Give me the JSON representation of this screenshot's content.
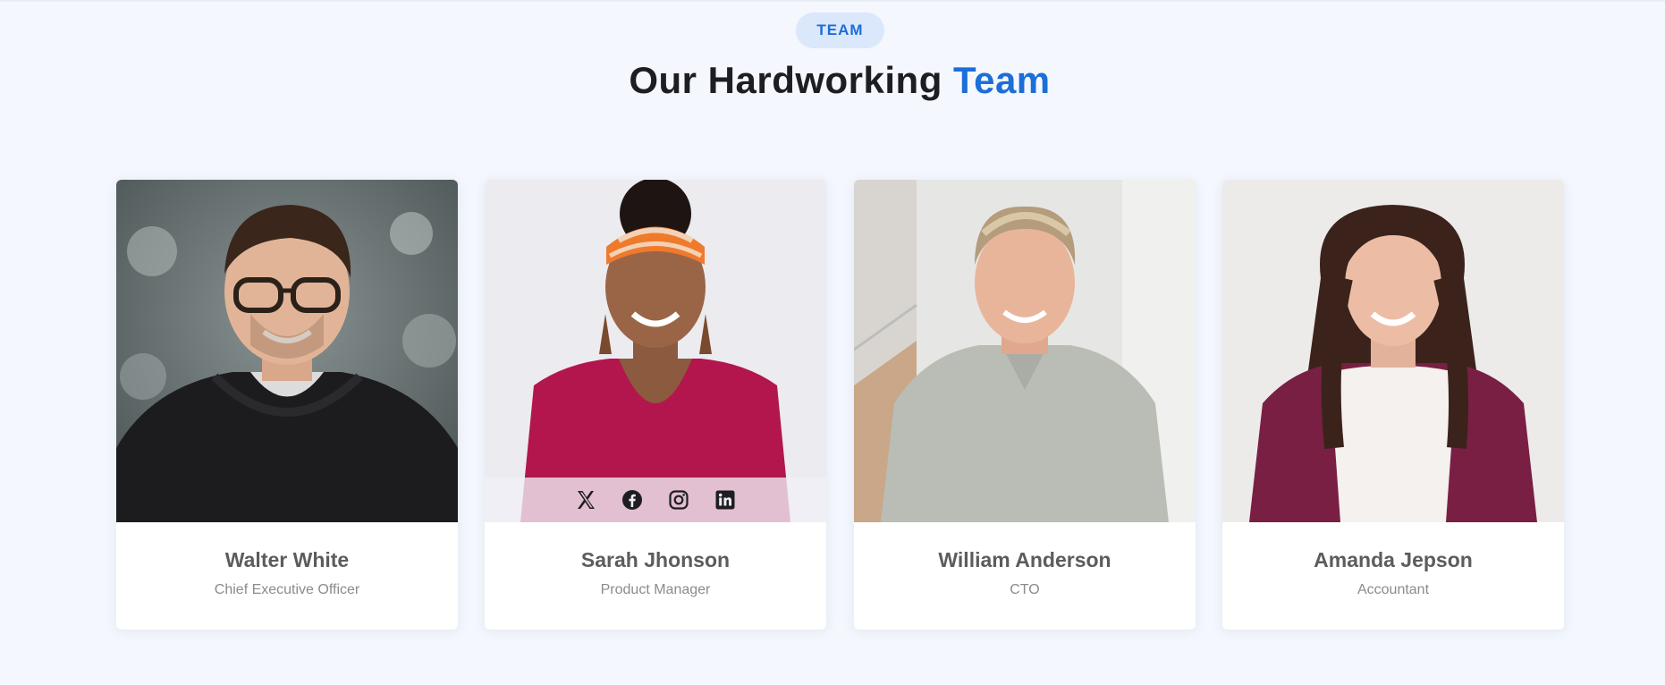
{
  "section": {
    "badge": "TEAM",
    "title_main": "Our Hardworking",
    "title_accent": "Team"
  },
  "members": [
    {
      "name": "Walter White",
      "role": "Chief Executive Officer"
    },
    {
      "name": "Sarah Jhonson",
      "role": "Product Manager"
    },
    {
      "name": "William Anderson",
      "role": "CTO"
    },
    {
      "name": "Amanda Jepson",
      "role": "Accountant"
    }
  ],
  "social_icons": [
    "x-twitter-icon",
    "facebook-icon",
    "instagram-icon",
    "linkedin-icon"
  ],
  "colors": {
    "accent": "#1c6ed8",
    "background": "#f4f7fd",
    "badge_bg": "#dbe7fa",
    "heading": "#1e1e22",
    "name_text": "#5c5c60",
    "role_text": "#8b8b90"
  }
}
